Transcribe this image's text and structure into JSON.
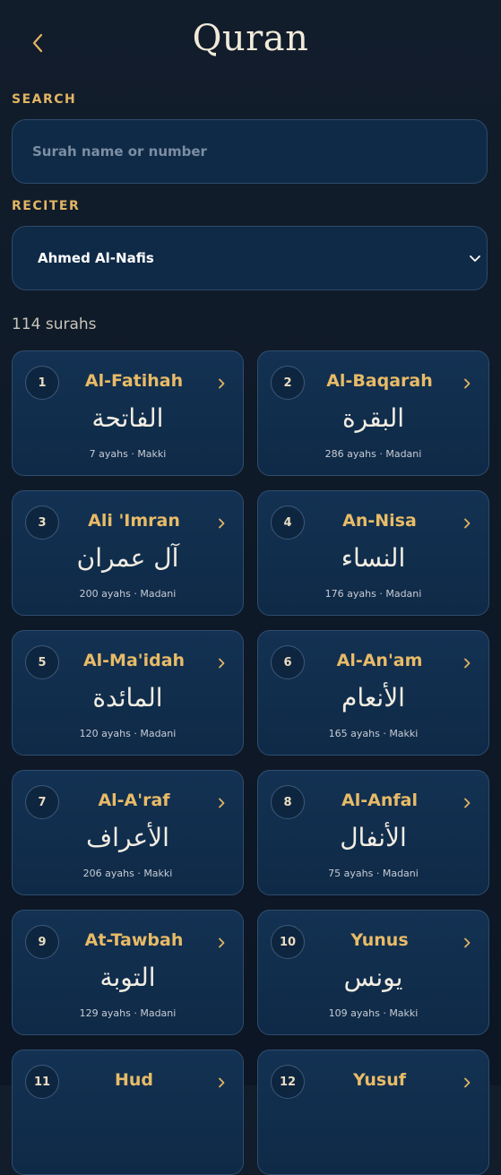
{
  "header": {
    "title": "Quran",
    "back_icon": "chevron-left-icon"
  },
  "search": {
    "label": "SEARCH",
    "placeholder": "Surah name or number",
    "value": ""
  },
  "reciter": {
    "label": "RECITER",
    "selected": "Ahmed Al-Nafis",
    "icon": "chevron-down-icon"
  },
  "surah_count": "114 surahs",
  "colors": {
    "accent": "#e8bb67",
    "card_bg": "#0f2a47",
    "border": "#2f4d6e",
    "background": "#0f1a28"
  },
  "surahs": [
    {
      "number": "1",
      "name": "Al-Fatihah",
      "arabic": "الفاتحة",
      "meta": "7 ayahs · Makki"
    },
    {
      "number": "2",
      "name": "Al-Baqarah",
      "arabic": "البقرة",
      "meta": "286 ayahs · Madani"
    },
    {
      "number": "3",
      "name": "Ali 'Imran",
      "arabic": "آل عمران",
      "meta": "200 ayahs · Madani"
    },
    {
      "number": "4",
      "name": "An-Nisa",
      "arabic": "النساء",
      "meta": "176 ayahs · Madani"
    },
    {
      "number": "5",
      "name": "Al-Ma'idah",
      "arabic": "المائدة",
      "meta": "120 ayahs · Madani"
    },
    {
      "number": "6",
      "name": "Al-An'am",
      "arabic": "الأنعام",
      "meta": "165 ayahs · Makki"
    },
    {
      "number": "7",
      "name": "Al-A'raf",
      "arabic": "الأعراف",
      "meta": "206 ayahs · Makki"
    },
    {
      "number": "8",
      "name": "Al-Anfal",
      "arabic": "الأنفال",
      "meta": "75 ayahs · Madani"
    },
    {
      "number": "9",
      "name": "At-Tawbah",
      "arabic": "التوبة",
      "meta": "129 ayahs · Madani"
    },
    {
      "number": "10",
      "name": "Yunus",
      "arabic": "يونس",
      "meta": "109 ayahs · Makki"
    },
    {
      "number": "11",
      "name": "Hud",
      "arabic": "",
      "meta": ""
    },
    {
      "number": "12",
      "name": "Yusuf",
      "arabic": "",
      "meta": ""
    }
  ]
}
